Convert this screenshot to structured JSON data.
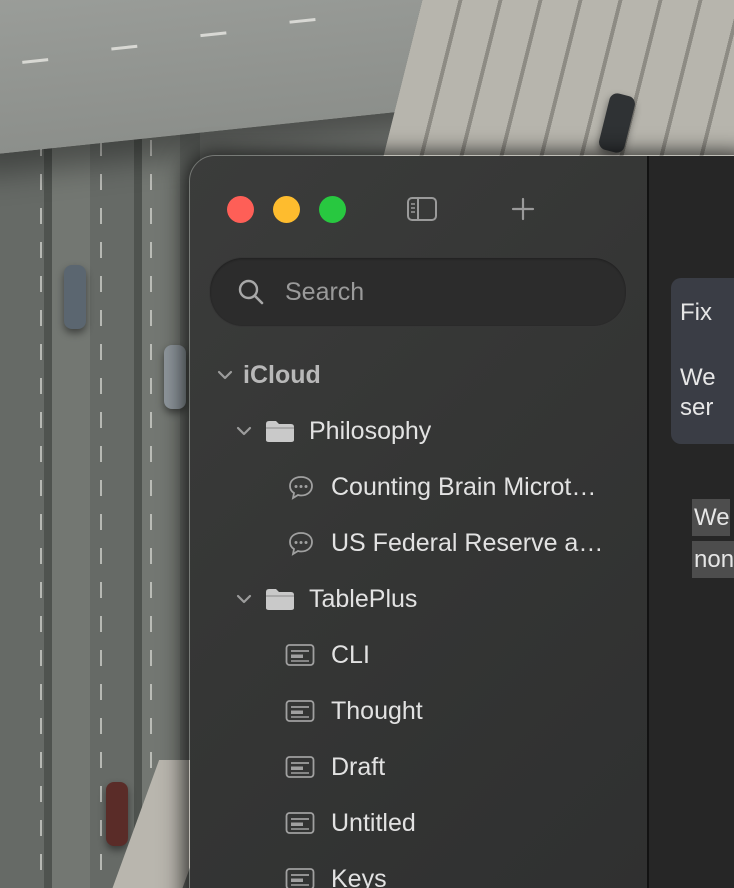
{
  "toolbar": {
    "sidebar_toggle": "sidebar-icon",
    "new_note": "plus-icon"
  },
  "search": {
    "placeholder": "Search"
  },
  "tree": {
    "account": "iCloud",
    "folders": [
      {
        "name": "Philosophy",
        "items": [
          {
            "label": "Counting Brain Microt…",
            "icon": "chat-bubble-icon"
          },
          {
            "label": "US Federal Reserve a…",
            "icon": "chat-bubble-icon"
          }
        ]
      },
      {
        "name": "TablePlus",
        "items": [
          {
            "label": "CLI",
            "icon": "note-icon"
          },
          {
            "label": "Thought",
            "icon": "note-icon"
          },
          {
            "label": "Draft",
            "icon": "note-icon"
          },
          {
            "label": "Untitled",
            "icon": "note-icon"
          },
          {
            "label": "Keys",
            "icon": "note-icon"
          }
        ]
      }
    ]
  },
  "content": {
    "card_title": "Fix",
    "card_line1": "We",
    "card_line2": "ser",
    "highlight_line1": "We",
    "highlight_line2": "non"
  },
  "colors": {
    "close": "#fe5f57",
    "minimize": "#febc2e",
    "zoom": "#28c840",
    "sidebar_bg": "#353635",
    "content_bg": "#262626",
    "card_bg": "#3a3d45"
  }
}
